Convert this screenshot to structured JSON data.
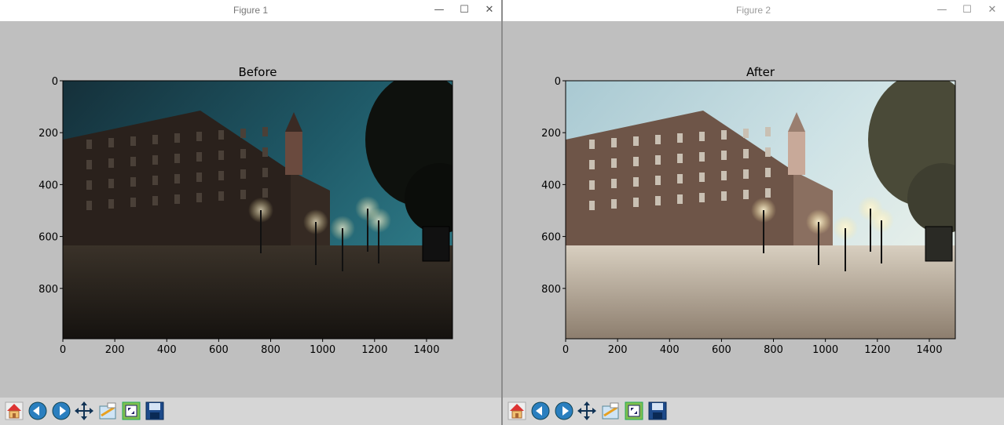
{
  "windows": [
    {
      "title": "Figure 1",
      "plot_title": "Before",
      "photo": "dark night photo of brick civic building with clock tower, street lamps, tree",
      "tonemap": "dark"
    },
    {
      "title": "Figure 2",
      "plot_title": "After",
      "photo": "enhanced brighter version of same photo",
      "tonemap": "bright"
    }
  ],
  "axes": {
    "x_ticks": [
      "0",
      "200",
      "400",
      "600",
      "800",
      "1000",
      "1200",
      "1400"
    ],
    "y_ticks": [
      "0",
      "200",
      "400",
      "600",
      "800"
    ]
  },
  "toolbar_icons": [
    "home-icon",
    "back-icon",
    "forward-icon",
    "pan-icon",
    "configure-subplots-icon",
    "zoom-icon",
    "save-icon"
  ],
  "colors": {
    "titlebar": "#ffffff",
    "figure_bg": "#bfbfbf",
    "toolbar_bg": "#d6d6d6"
  }
}
